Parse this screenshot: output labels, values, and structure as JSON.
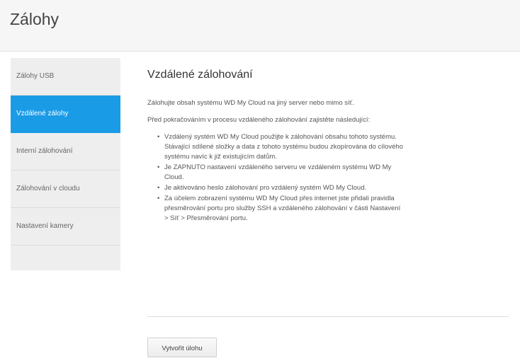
{
  "page": {
    "title": "Zálohy"
  },
  "sidebar": {
    "items": [
      {
        "label": "Zálohy USB"
      },
      {
        "label": "Vzdálené zálohy"
      },
      {
        "label": "Interní zálohování"
      },
      {
        "label": "Zálohování v cloudu"
      },
      {
        "label": "Nastavení kamery"
      }
    ]
  },
  "main": {
    "title": "Vzdálené zálohování",
    "intro": "Zálohujte obsah systému WD My Cloud na jiný server nebo mimo síť.",
    "prereq": "Před pokračováním v procesu vzdáleného zálohování zajistěte následující:",
    "bullets": [
      "Vzdálený systém WD My Cloud použijte k zálohování obsahu tohoto systému. Stávající sdílené složky a data z tohoto systému budou zkopírována do cílového systému navíc k již existujícím datům.",
      "Je ZAPNUTO nastavení vzdáleného serveru ve vzdáleném systému WD My Cloud.",
      "Je aktivováno heslo zálohování pro vzdálený systém WD My Cloud.",
      "Za účelem zobrazení systému WD My Cloud přes internet jste přidali pravidla přesměrování portu pro služby SSH a vzdáleného zálohování v části Nastavení > Síť > Přesměrování portu."
    ],
    "create_button": "Vytvořit úlohu"
  },
  "colors": {
    "accent": "#1a9be6"
  }
}
